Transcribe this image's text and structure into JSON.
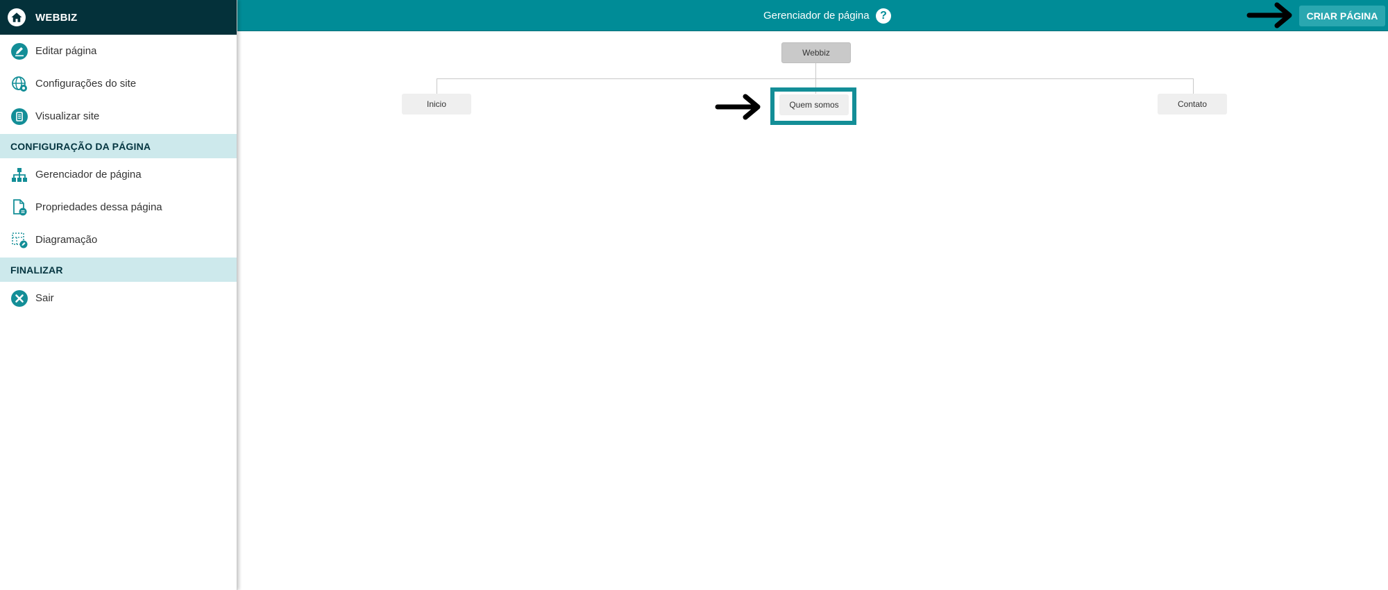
{
  "sidebar": {
    "brand": {
      "title": "WEBBIZ",
      "icon": "home-icon"
    },
    "items_top": [
      {
        "label": "Editar página",
        "icon": "edit-page-icon"
      },
      {
        "label": "Configurações do site",
        "icon": "globe-settings-icon"
      },
      {
        "label": "Visualizar site",
        "icon": "view-site-icon"
      }
    ],
    "section_page": "CONFIGURAÇÃO DA PÁGINA",
    "items_page": [
      {
        "label": "Gerenciador de página",
        "icon": "sitemap-icon"
      },
      {
        "label": "Propriedades dessa página",
        "icon": "page-properties-icon"
      },
      {
        "label": "Diagramação",
        "icon": "layout-icon"
      }
    ],
    "section_finish": "FINALIZAR",
    "items_finish": [
      {
        "label": "Sair",
        "icon": "close-circle-icon"
      }
    ]
  },
  "topbar": {
    "title": "Gerenciador de página",
    "help_symbol": "?",
    "create_button": "CRIAR PÁGINA"
  },
  "tree": {
    "root": "Webbiz",
    "children": [
      "Inicio",
      "Quem somos",
      "Contato"
    ]
  },
  "colors": {
    "brand_bg": "#04313a",
    "topbar_bg": "#008c97",
    "section_bg": "#cde9ec",
    "accent": "#138e97",
    "button_bg": "#2aa7b0"
  }
}
